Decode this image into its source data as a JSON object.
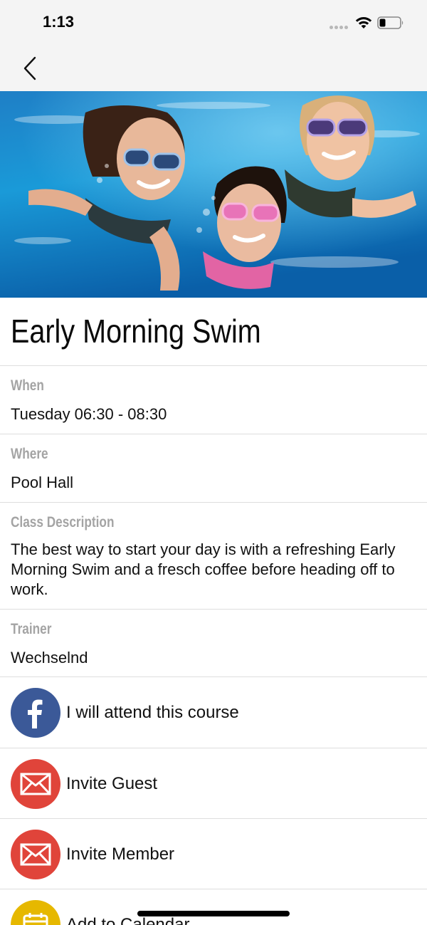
{
  "status_bar": {
    "time": "1:13"
  },
  "event": {
    "title": "Early Morning Swim",
    "hero_image": "children-swimming-underwater-photo"
  },
  "details": [
    {
      "label": "When",
      "value": "Tuesday 06:30 - 08:30"
    },
    {
      "label": "Where",
      "value": "Pool Hall"
    },
    {
      "label": "Class Description",
      "value": "The best way to start your day is with a refreshing Early Morning Swim and a fresch coffee before heading off to work."
    },
    {
      "label": "Trainer",
      "value": "Wechselnd"
    }
  ],
  "actions": [
    {
      "label": "I will attend this course",
      "icon": "facebook-icon",
      "color": "#3b5998"
    },
    {
      "label": "Invite Guest",
      "icon": "mail-icon",
      "color": "#e0443a"
    },
    {
      "label": "Invite Member",
      "icon": "mail-icon",
      "color": "#e0443a"
    },
    {
      "label": "Add to Calendar",
      "icon": "calendar-icon",
      "color": "#e6b800"
    }
  ]
}
